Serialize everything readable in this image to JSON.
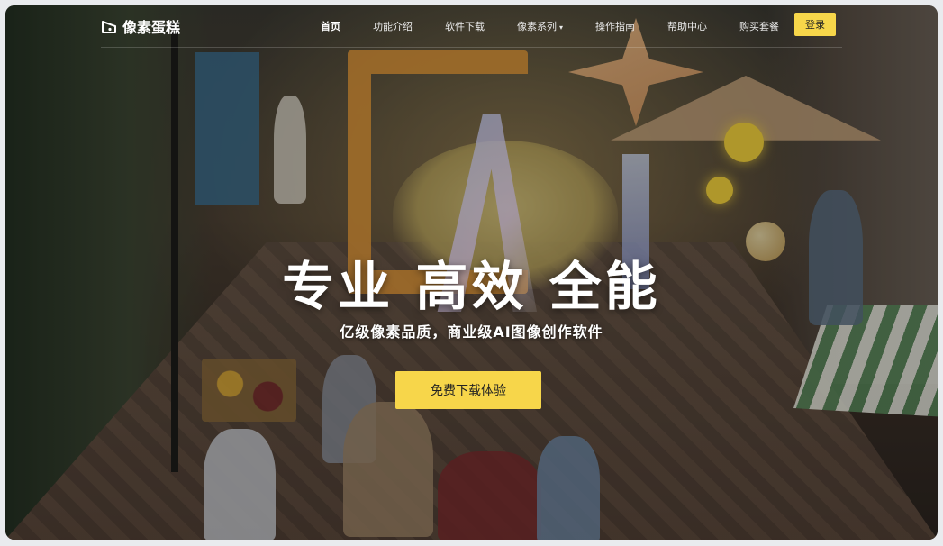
{
  "brand": {
    "name": "像素蛋糕",
    "logo_icon": "cake-logo-icon"
  },
  "nav": {
    "items": [
      {
        "label": "首页",
        "active": true
      },
      {
        "label": "功能介绍",
        "active": false
      },
      {
        "label": "软件下载",
        "active": false
      },
      {
        "label": "像素系列",
        "active": false,
        "dropdown": true
      },
      {
        "label": "操作指南",
        "active": false
      },
      {
        "label": "帮助中心",
        "active": false
      },
      {
        "label": "购买套餐",
        "active": false
      }
    ],
    "dropdown_caret": "▾",
    "login_label": "登录"
  },
  "hero": {
    "title": "专业 高效 全能",
    "subtitle": "亿级像素品质，商业级AI图像创作软件",
    "cta_label": "免费下载体验"
  },
  "colors": {
    "accent": "#f7d64a",
    "nav_text": "#e9e9e9",
    "hero_text": "#ffffff"
  }
}
